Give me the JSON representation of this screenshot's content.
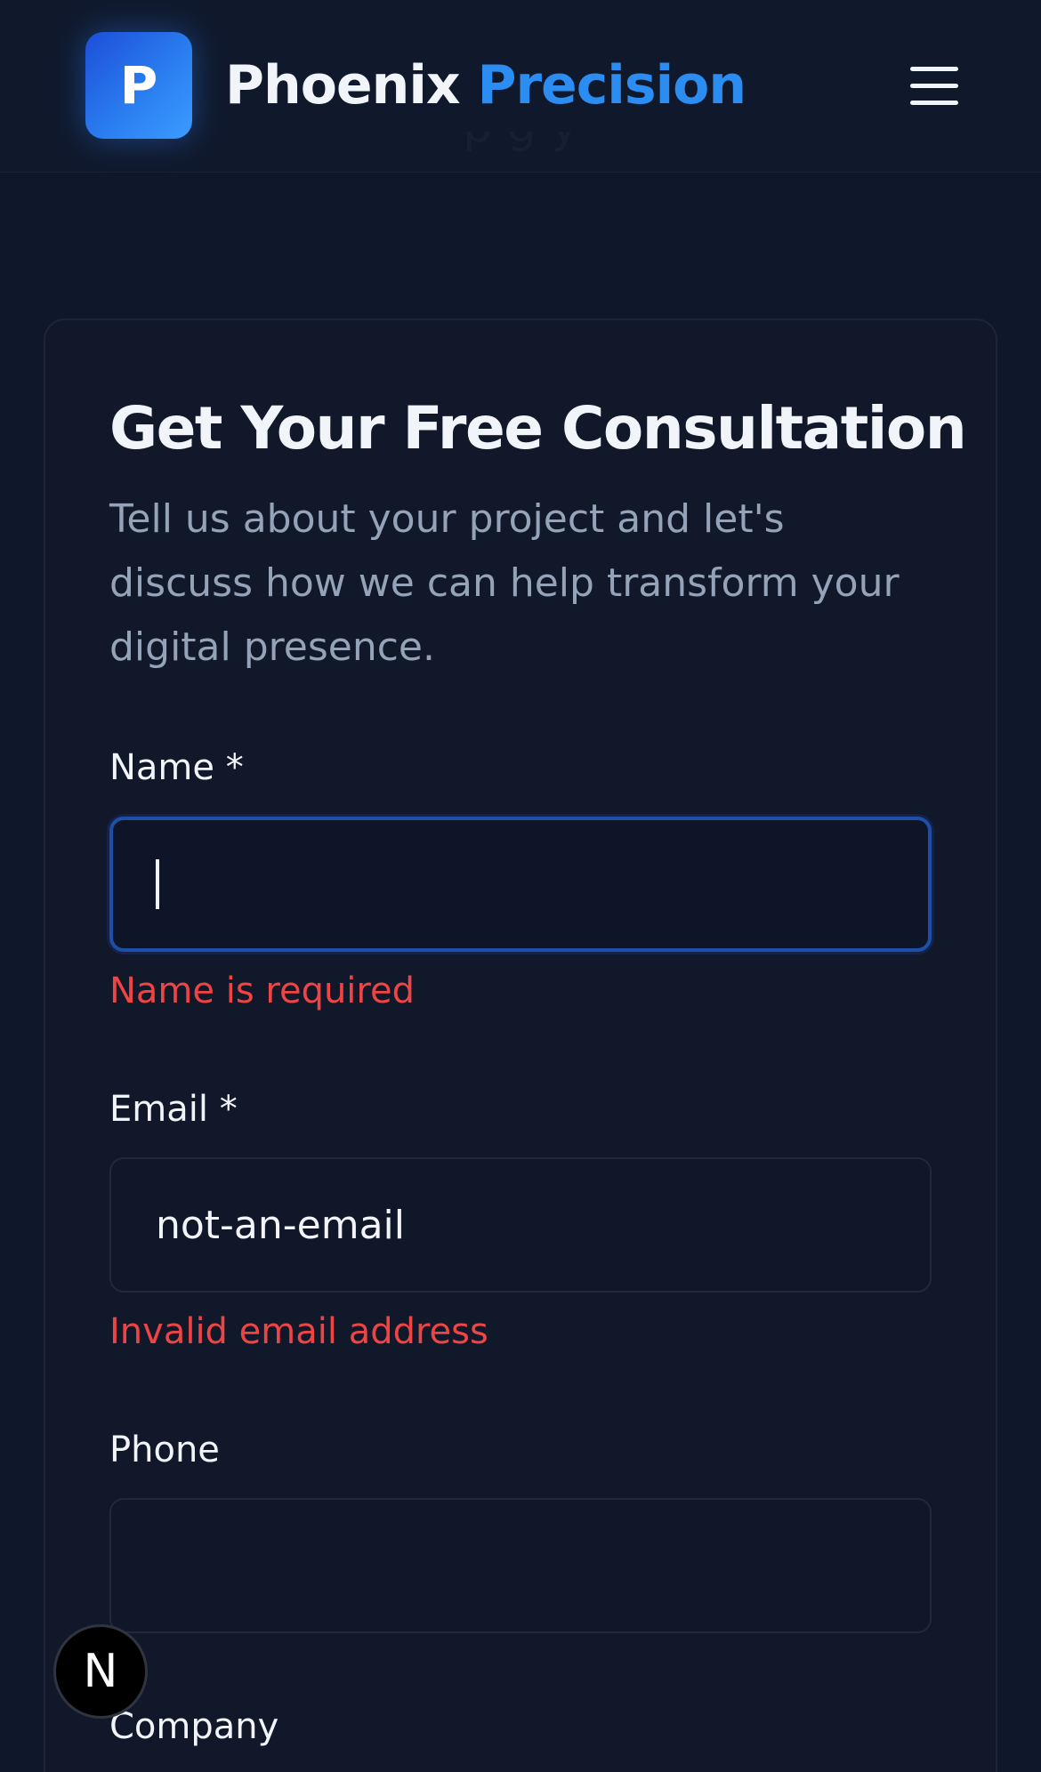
{
  "header": {
    "logo_letter": "P",
    "brand_part1": "Phoenix",
    "brand_part2": "Precision"
  },
  "form": {
    "title": "Get Your Free Consultation",
    "description": "Tell us about your project and let's discuss how we can help transform your digital presence.",
    "fields": {
      "name": {
        "label": "Name *",
        "value": "",
        "error": "Name is required"
      },
      "email": {
        "label": "Email *",
        "value": "not-an-email",
        "error": "Invalid email address"
      },
      "phone": {
        "label": "Phone",
        "value": ""
      },
      "company": {
        "label": "Company"
      }
    }
  },
  "dev_badge": {
    "letter": "N"
  },
  "colors": {
    "background": "#0f172a",
    "accent": "#2b8cf2",
    "error": "#ef4444",
    "muted_text": "#94a3b8"
  }
}
